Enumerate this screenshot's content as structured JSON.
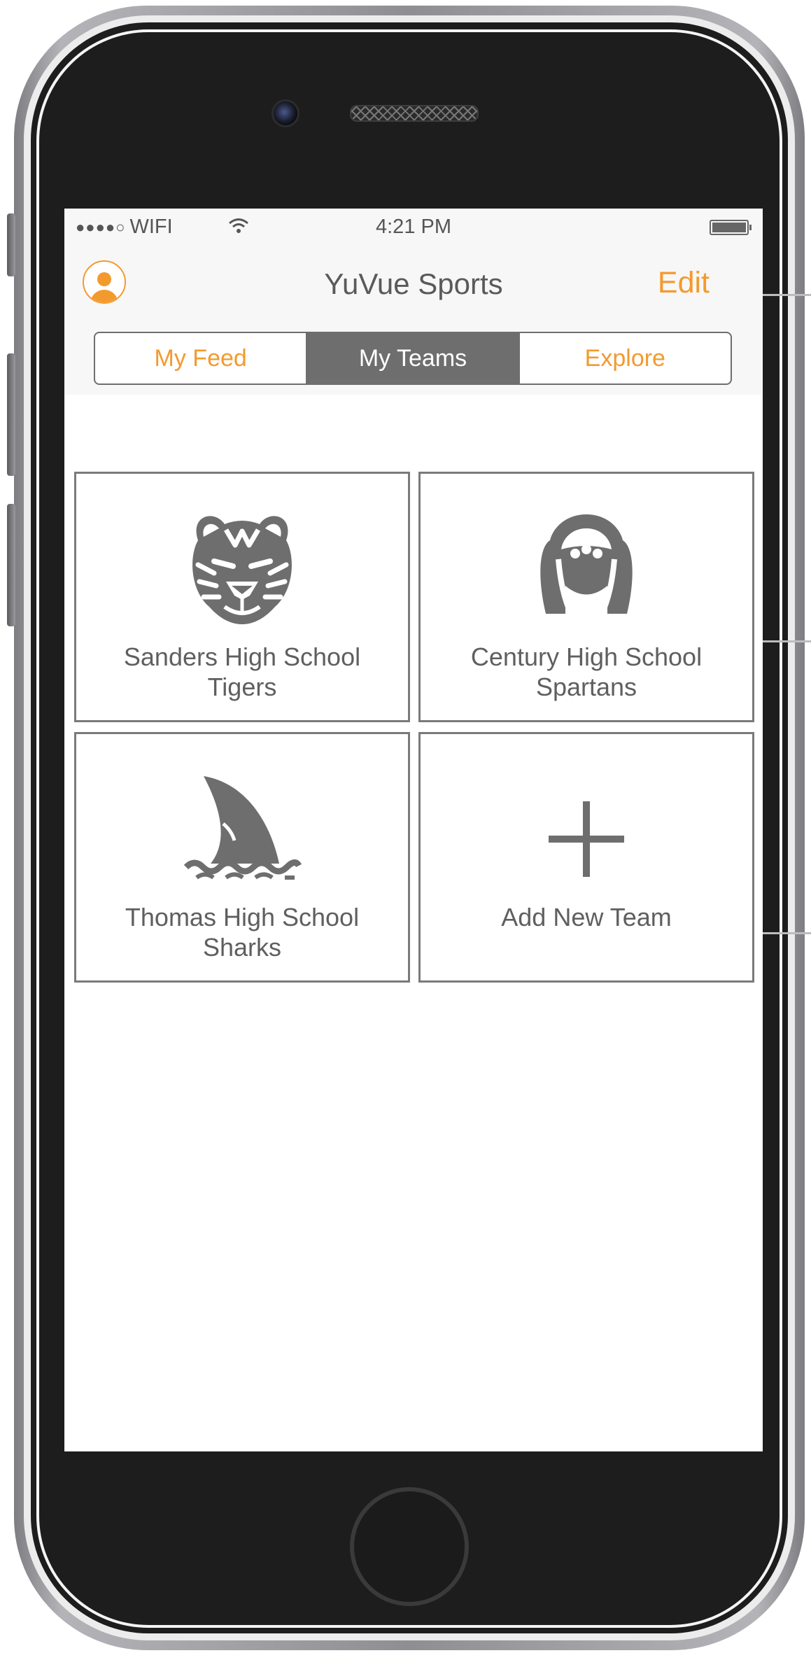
{
  "status_bar": {
    "signal": "●●●●○",
    "carrier": "WIFI",
    "time": "4:21 PM"
  },
  "nav": {
    "title": "YuVue Sports",
    "edit_label": "Edit"
  },
  "segments": {
    "items": [
      {
        "label": "My Feed",
        "active": false
      },
      {
        "label": "My Teams",
        "active": true
      },
      {
        "label": "Explore",
        "active": false
      }
    ]
  },
  "teams": [
    {
      "line1": "Sanders High School",
      "line2": "Tigers",
      "icon": "tiger-icon"
    },
    {
      "line1": "Century High School",
      "line2": "Spartans",
      "icon": "spartan-helmet-icon"
    },
    {
      "line1": "Thomas High School",
      "line2": "Sharks",
      "icon": "shark-fin-icon"
    },
    {
      "line1": "Add New Team",
      "line2": "",
      "icon": "plus-icon"
    }
  ],
  "colors": {
    "accent": "#f39a2e",
    "segment_active": "#6e6e6e",
    "icon_grey": "#6e6e6e",
    "text_grey": "#5f5f5f"
  }
}
